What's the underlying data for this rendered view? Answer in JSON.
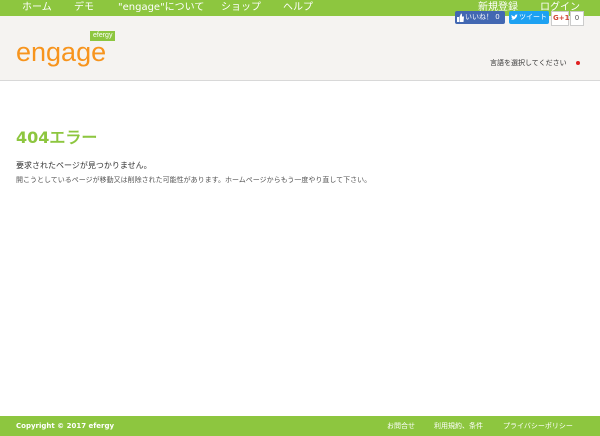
{
  "nav": {
    "home": "ホーム",
    "demo": "デモ",
    "about": "\"engage\"について",
    "shop": "ショップ",
    "help": "ヘルプ",
    "register": "新規登録",
    "login": "ログイン"
  },
  "brand": {
    "logo": "engage",
    "badge": "efergy"
  },
  "social": {
    "like_label": "いいね！ 0",
    "tweet_label": "ツイート",
    "gplus_label": "G+1",
    "gplus_count": "0"
  },
  "language": {
    "select_label": "言語を選択してください"
  },
  "error": {
    "title": "404エラー",
    "message": "要求されたページが見つかりません。",
    "detail": "開こうとしているページが移動又は削除された可能性があります。ホームページからもう一度やり直して下さい。"
  },
  "footer": {
    "copyright": "Copyright © 2017 efergy",
    "contact": "お問合せ",
    "terms": "利用規約、条件",
    "privacy": "プライバシーポリシー"
  },
  "colors": {
    "brand_green": "#8dc63f",
    "logo_orange": "#f7941d",
    "facebook_blue": "#4267b2",
    "twitter_blue": "#1da1f2"
  }
}
